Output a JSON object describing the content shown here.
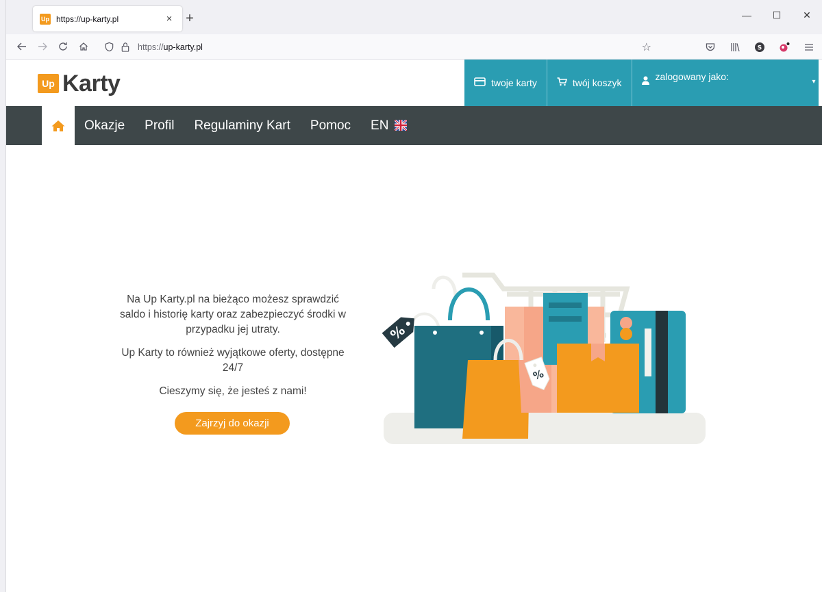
{
  "browser": {
    "tab_title": "https://up-karty.pl",
    "favicon_text": "Up",
    "tab_close": "×",
    "new_tab": "+",
    "url_scheme": "https://",
    "url_host": "up-karty.pl",
    "window_controls": {
      "minimize": "—",
      "maximize": "☐",
      "close": "✕"
    }
  },
  "header": {
    "logo_box": "Up",
    "logo_text": "Karty",
    "links": [
      {
        "label": "twoje karty",
        "icon": "card-icon"
      },
      {
        "label": "twój koszyk",
        "icon": "cart-icon"
      }
    ],
    "user_label": "zalogowany jako:",
    "user_caret": "▾"
  },
  "menu": {
    "items": [
      "Okazje",
      "Profil",
      "Regulaminy Kart",
      "Pomoc"
    ],
    "lang": "EN"
  },
  "hero": {
    "paragraph1": "Na Up Karty.pl na bieżąco możesz sprawdzić saldo i historię karty oraz zabezpieczyć środki w przypadku jej utraty.",
    "paragraph2": "Up Karty to również wyjątkowe oferty, dostępne 24/7",
    "paragraph3": "Cieszymy się, że jesteś z nami!",
    "cta_label": "Zajrzyj do okazji",
    "tag_label": "%"
  },
  "colors": {
    "accent_orange": "#f39a1e",
    "header_teal": "#2a9db2",
    "menu_dark": "#3e4749",
    "bag_teal": "#1f6f80"
  }
}
